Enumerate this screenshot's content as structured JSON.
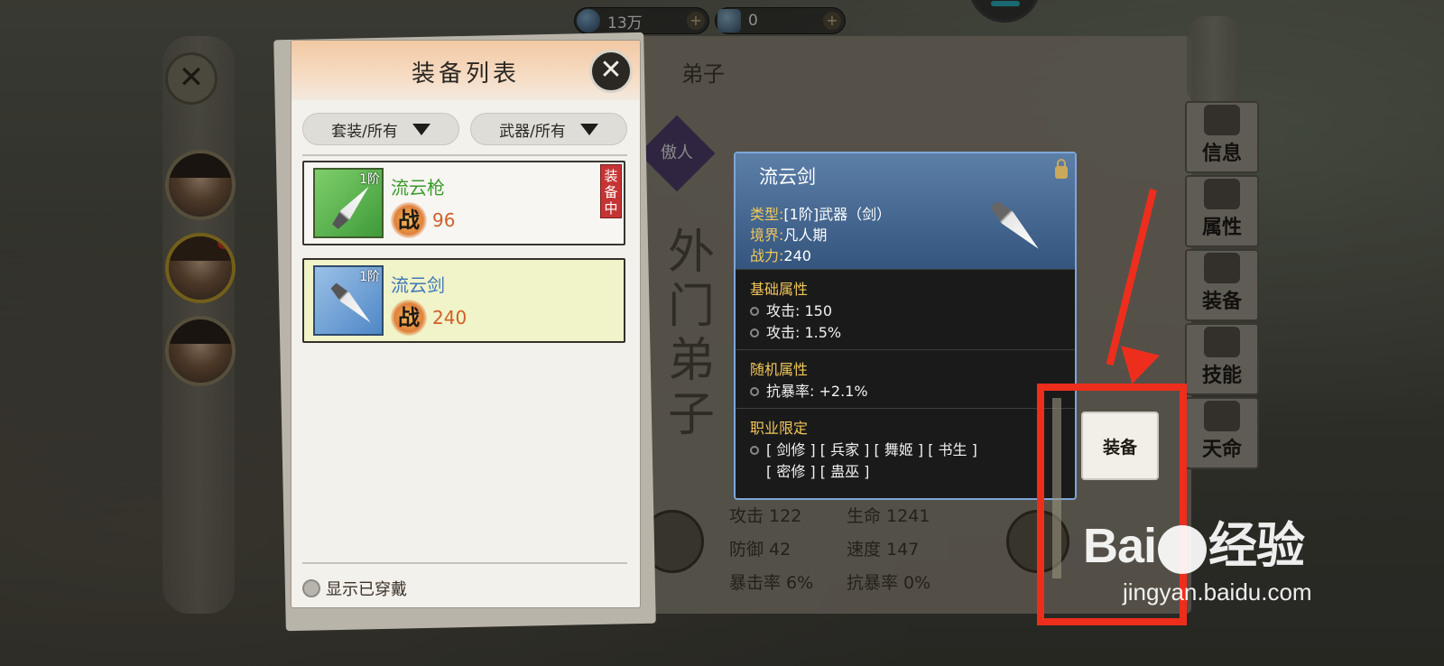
{
  "currency": {
    "spirit_stones": "13万",
    "tickets": "0"
  },
  "book": {
    "tab_label": "弟子",
    "stamp": "傲人",
    "calligraphy": "外门弟子",
    "stats": [
      [
        "攻击 122",
        "生命 1241"
      ],
      [
        "防御 42",
        "速度 147"
      ],
      [
        "暴击率 6%",
        "抗暴率 0%"
      ]
    ]
  },
  "side_tabs": [
    "信息",
    "属性",
    "装备",
    "技能",
    "天命"
  ],
  "panel": {
    "title": "装备列表",
    "filter_set": "套装/所有",
    "filter_type": "武器/所有",
    "show_worn": "显示已穿戴",
    "items": [
      {
        "tier": "1阶",
        "name": "流云枪",
        "power_char": "战",
        "power": "96",
        "badge": "装备中",
        "color": "green"
      },
      {
        "tier": "1阶",
        "name": "流云剑",
        "power_char": "战",
        "power": "240",
        "color": "blue"
      }
    ]
  },
  "tooltip": {
    "title": "流云剑",
    "type_label": "类型:",
    "type_value": "[1阶]武器（剑）",
    "realm_label": "境界:",
    "realm_value": "凡人期",
    "power_label": "战力:",
    "power_value": "240",
    "base_heading": "基础属性",
    "base_lines": [
      "攻击: 150",
      "攻击: 1.5%"
    ],
    "random_heading": "随机属性",
    "random_lines": [
      "抗暴率: +2.1%"
    ],
    "class_heading": "职业限定",
    "class_line1": "[ 剑修 ] [ 兵家 ] [ 舞姬 ] [ 书生 ]",
    "class_line2": "[ 密修 ] [ 蛊巫 ]"
  },
  "equip_button": "装备",
  "watermark": {
    "logo_left": "Bai",
    "logo_right": "经验",
    "url": "jingyan.baidu.com"
  },
  "colors": {
    "annotation": "#ee2e1c",
    "tooltip_border": "#7ea6d8",
    "green_name": "#3c9a2c",
    "blue_name": "#3d78b8",
    "power": "#d0602a"
  }
}
